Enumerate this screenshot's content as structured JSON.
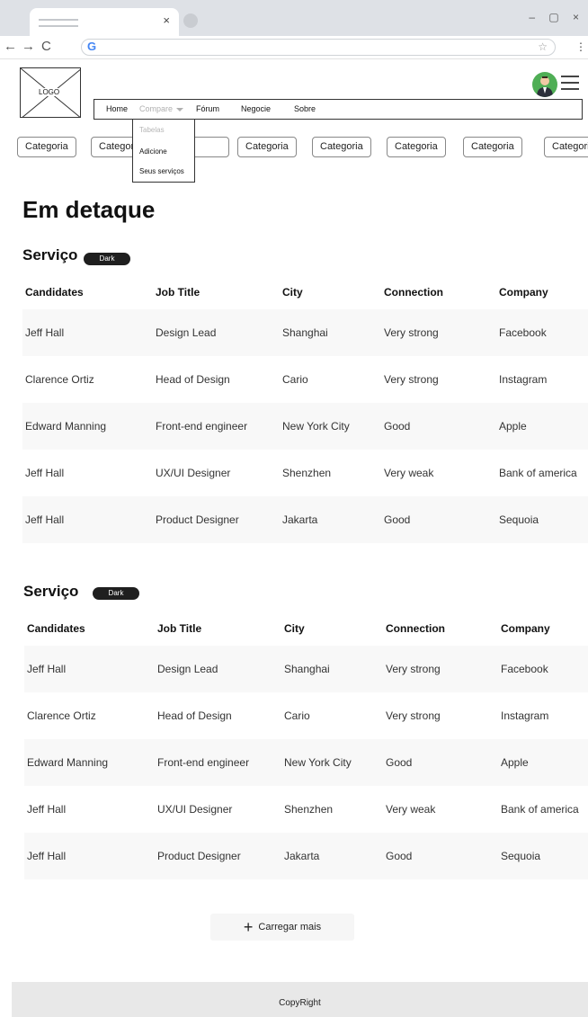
{
  "browser": {
    "tab_close_glyph": "×",
    "window_controls": "– ▢ ×",
    "back_glyph": "←",
    "forward_glyph": "→",
    "reload_glyph": "C",
    "omnibox_icon": "G",
    "bookmark_glyph": "☆",
    "menu_glyph": "⋮"
  },
  "header": {
    "logo_text": "LOGO",
    "nav": {
      "home": "Home",
      "compare": "Compare",
      "forum": "Fórum",
      "negocie": "Negocie",
      "sobre": "Sobre"
    },
    "dropdown": [
      "Tabelas",
      "Adicione",
      "Seus serviços"
    ]
  },
  "categories": [
    "Categoria",
    "Categoria",
    "Categoria",
    "Categoria",
    "Categoria",
    "Categoria",
    "Categoria",
    "Categoria"
  ],
  "main": {
    "title": "Em detaque",
    "load_more": "Carregar mais",
    "load_more_icon": "+"
  },
  "sections": [
    {
      "title": "Serviço",
      "badge": "Dark",
      "columns": [
        "Candidates",
        "Job Title",
        "City",
        "Connection",
        "Company"
      ],
      "rows": [
        [
          "Jeff Hall",
          "Design Lead",
          "Shanghai",
          "Very strong",
          "Facebook"
        ],
        [
          "Clarence Ortiz",
          "Head of Design",
          "Cario",
          "Very strong",
          "Instagram"
        ],
        [
          "Edward Manning",
          "Front-end engineer",
          "New York City",
          "Good",
          "Apple"
        ],
        [
          "Jeff Hall",
          "UX/UI Designer",
          "Shenzhen",
          "Very weak",
          "Bank of america"
        ],
        [
          "Jeff Hall",
          "Product Designer",
          "Jakarta",
          "Good",
          "Sequoia"
        ]
      ]
    },
    {
      "title": "Serviço",
      "badge": "Dark",
      "columns": [
        "Candidates",
        "Job Title",
        "City",
        "Connection",
        "Company"
      ],
      "rows": [
        [
          "Jeff Hall",
          "Design Lead",
          "Shanghai",
          "Very strong",
          "Facebook"
        ],
        [
          "Clarence Ortiz",
          "Head of Design",
          "Cario",
          "Very strong",
          "Instagram"
        ],
        [
          "Edward Manning",
          "Front-end engineer",
          "New York City",
          "Good",
          "Apple"
        ],
        [
          "Jeff Hall",
          "UX/UI Designer",
          "Shenzhen",
          "Very weak",
          "Bank of america"
        ],
        [
          "Jeff Hall",
          "Product Designer",
          "Jakarta",
          "Good",
          "Sequoia"
        ]
      ]
    }
  ],
  "footer": {
    "text": "CopyRight"
  },
  "colors": {
    "badge": "#1f1f1f",
    "row_alt": "#f8f8f8",
    "avatar_bg": "#4fae55",
    "footer_bg": "#e8e8e8"
  }
}
